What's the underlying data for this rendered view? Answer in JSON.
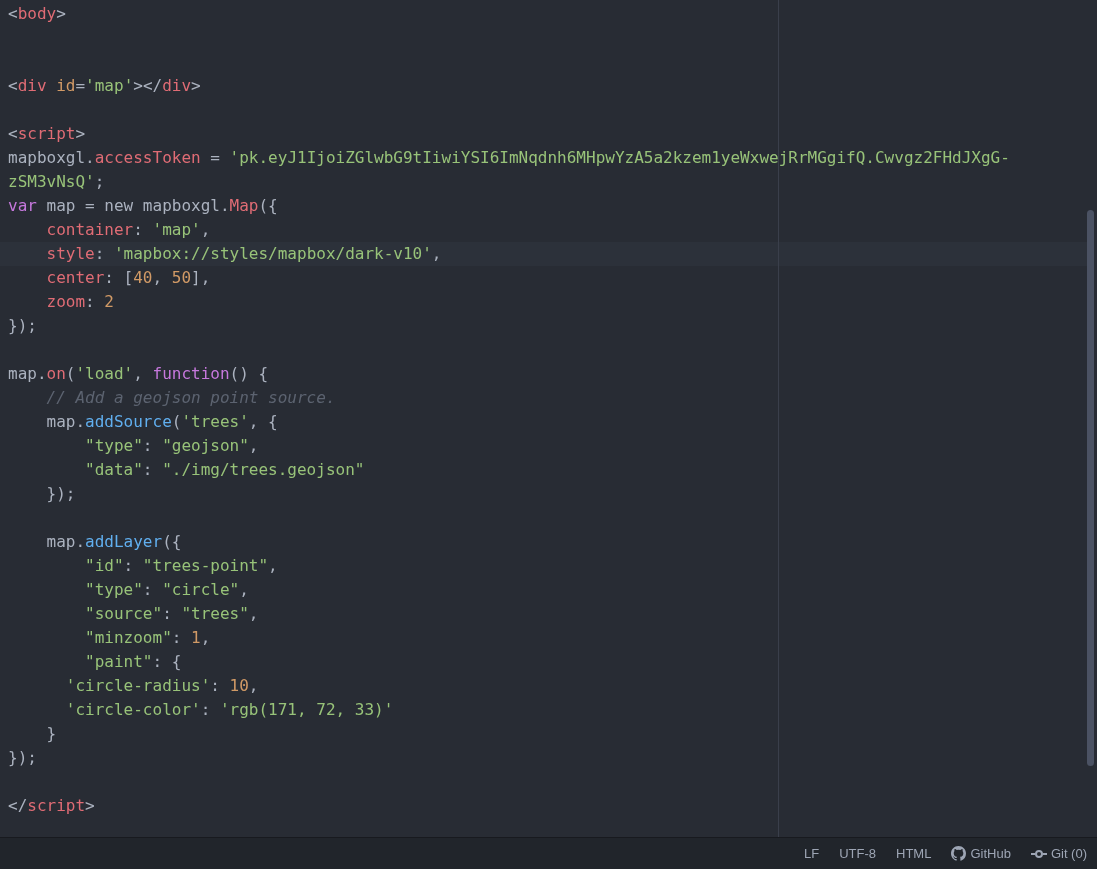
{
  "editor": {
    "lines": [
      {
        "highlighted": false,
        "tokens": [
          {
            "kind": "punct",
            "text": "<"
          },
          {
            "kind": "tag",
            "text": "body"
          },
          {
            "kind": "punct",
            "text": ">"
          }
        ]
      },
      {
        "kind": "blank"
      },
      {
        "kind": "blank"
      },
      {
        "highlighted": false,
        "tokens": [
          {
            "kind": "punct",
            "text": "<"
          },
          {
            "kind": "tag",
            "text": "div"
          },
          {
            "kind": "attr",
            "text": " id"
          },
          {
            "kind": "punct",
            "text": "="
          },
          {
            "kind": "string",
            "text": "'map'"
          },
          {
            "kind": "punct",
            "text": "></"
          },
          {
            "kind": "tag",
            "text": "div"
          },
          {
            "kind": "punct",
            "text": ">"
          }
        ]
      },
      {
        "kind": "blank"
      },
      {
        "highlighted": false,
        "tokens": [
          {
            "kind": "punct",
            "text": "<"
          },
          {
            "kind": "tag",
            "text": "script"
          },
          {
            "kind": "punct",
            "text": ">"
          }
        ]
      },
      {
        "highlighted": false,
        "tokens": [
          {
            "kind": "plain",
            "text": "mapboxgl."
          },
          {
            "kind": "prop",
            "text": "accessToken"
          },
          {
            "kind": "plain",
            "text": " = "
          },
          {
            "kind": "string",
            "text": "'pk.eyJ1IjoiZGlwbG9tIiwiYSI6ImNqdnh6MHpwYzA5a2kzem1yeWxwejRrMGgifQ.Cwvgz2FHdJXgG-"
          }
        ]
      },
      {
        "highlighted": false,
        "tokens": [
          {
            "kind": "string",
            "text": "zSM3vNsQ'"
          },
          {
            "kind": "plain",
            "text": ";"
          }
        ]
      },
      {
        "highlighted": false,
        "tokens": [
          {
            "kind": "keyword",
            "text": "var"
          },
          {
            "kind": "plain",
            "text": " map = new mapboxgl."
          },
          {
            "kind": "prop",
            "text": "Map"
          },
          {
            "kind": "plain",
            "text": "({"
          }
        ]
      },
      {
        "highlighted": false,
        "tokens": [
          {
            "kind": "prop",
            "text": "    container"
          },
          {
            "kind": "plain",
            "text": ": "
          },
          {
            "kind": "string",
            "text": "'map'"
          },
          {
            "kind": "plain",
            "text": ","
          }
        ]
      },
      {
        "highlighted": true,
        "tokens": [
          {
            "kind": "prop",
            "text": "    style"
          },
          {
            "kind": "plain",
            "text": ": "
          },
          {
            "kind": "string",
            "text": "'mapbox://styles/mapbox/dark-v10'"
          },
          {
            "kind": "plain",
            "text": ","
          }
        ]
      },
      {
        "highlighted": false,
        "tokens": [
          {
            "kind": "prop",
            "text": "    center"
          },
          {
            "kind": "plain",
            "text": ": ["
          },
          {
            "kind": "number",
            "text": "40"
          },
          {
            "kind": "plain",
            "text": ", "
          },
          {
            "kind": "number",
            "text": "50"
          },
          {
            "kind": "plain",
            "text": "],"
          }
        ]
      },
      {
        "highlighted": false,
        "tokens": [
          {
            "kind": "prop",
            "text": "    zoom"
          },
          {
            "kind": "plain",
            "text": ": "
          },
          {
            "kind": "number",
            "text": "2"
          }
        ]
      },
      {
        "highlighted": false,
        "tokens": [
          {
            "kind": "plain",
            "text": "});"
          }
        ]
      },
      {
        "kind": "blank"
      },
      {
        "highlighted": false,
        "tokens": [
          {
            "kind": "plain",
            "text": "map."
          },
          {
            "kind": "prop",
            "text": "on"
          },
          {
            "kind": "plain",
            "text": "("
          },
          {
            "kind": "string",
            "text": "'load'"
          },
          {
            "kind": "plain",
            "text": ", "
          },
          {
            "kind": "keyword",
            "text": "function"
          },
          {
            "kind": "plain",
            "text": "() {"
          }
        ]
      },
      {
        "highlighted": false,
        "tokens": [
          {
            "kind": "comment",
            "text": "    // Add a geojson point source."
          }
        ]
      },
      {
        "highlighted": false,
        "tokens": [
          {
            "kind": "plain",
            "text": "    map."
          },
          {
            "kind": "func",
            "text": "addSource"
          },
          {
            "kind": "plain",
            "text": "("
          },
          {
            "kind": "string",
            "text": "'trees'"
          },
          {
            "kind": "plain",
            "text": ", {"
          }
        ]
      },
      {
        "highlighted": false,
        "tokens": [
          {
            "kind": "string",
            "text": "        \"type\""
          },
          {
            "kind": "plain",
            "text": ": "
          },
          {
            "kind": "string",
            "text": "\"geojson\""
          },
          {
            "kind": "plain",
            "text": ","
          }
        ]
      },
      {
        "highlighted": false,
        "tokens": [
          {
            "kind": "string",
            "text": "        \"data\""
          },
          {
            "kind": "plain",
            "text": ": "
          },
          {
            "kind": "string",
            "text": "\"./img/trees.geojson\""
          }
        ]
      },
      {
        "highlighted": false,
        "tokens": [
          {
            "kind": "plain",
            "text": "    });"
          }
        ]
      },
      {
        "kind": "blank"
      },
      {
        "highlighted": false,
        "tokens": [
          {
            "kind": "plain",
            "text": "    map."
          },
          {
            "kind": "func",
            "text": "addLayer"
          },
          {
            "kind": "plain",
            "text": "({"
          }
        ]
      },
      {
        "highlighted": false,
        "tokens": [
          {
            "kind": "string",
            "text": "        \"id\""
          },
          {
            "kind": "plain",
            "text": ": "
          },
          {
            "kind": "string",
            "text": "\"trees-point\""
          },
          {
            "kind": "plain",
            "text": ","
          }
        ]
      },
      {
        "highlighted": false,
        "tokens": [
          {
            "kind": "string",
            "text": "        \"type\""
          },
          {
            "kind": "plain",
            "text": ": "
          },
          {
            "kind": "string",
            "text": "\"circle\""
          },
          {
            "kind": "plain",
            "text": ","
          }
        ]
      },
      {
        "highlighted": false,
        "tokens": [
          {
            "kind": "string",
            "text": "        \"source\""
          },
          {
            "kind": "plain",
            "text": ": "
          },
          {
            "kind": "string",
            "text": "\"trees\""
          },
          {
            "kind": "plain",
            "text": ","
          }
        ]
      },
      {
        "highlighted": false,
        "tokens": [
          {
            "kind": "string",
            "text": "        \"minzoom\""
          },
          {
            "kind": "plain",
            "text": ": "
          },
          {
            "kind": "number",
            "text": "1"
          },
          {
            "kind": "plain",
            "text": ","
          }
        ]
      },
      {
        "highlighted": false,
        "tokens": [
          {
            "kind": "string",
            "text": "        \"paint\""
          },
          {
            "kind": "plain",
            "text": ": {"
          }
        ]
      },
      {
        "highlighted": false,
        "tokens": [
          {
            "kind": "string",
            "text": "      'circle-radius'"
          },
          {
            "kind": "plain",
            "text": ": "
          },
          {
            "kind": "number",
            "text": "10"
          },
          {
            "kind": "plain",
            "text": ","
          }
        ]
      },
      {
        "highlighted": false,
        "tokens": [
          {
            "kind": "string",
            "text": "      'circle-color'"
          },
          {
            "kind": "plain",
            "text": ": "
          },
          {
            "kind": "string",
            "text": "'rgb(171, 72, 33)'"
          }
        ]
      },
      {
        "highlighted": false,
        "tokens": [
          {
            "kind": "plain",
            "text": "    }"
          }
        ]
      },
      {
        "highlighted": false,
        "tokens": [
          {
            "kind": "plain",
            "text": "});"
          }
        ]
      },
      {
        "kind": "blank"
      },
      {
        "highlighted": false,
        "tokens": [
          {
            "kind": "punct",
            "text": "</"
          },
          {
            "kind": "tag",
            "text": "script"
          },
          {
            "kind": "punct",
            "text": ">"
          }
        ]
      }
    ]
  },
  "status_bar": {
    "items": [
      {
        "kind": "text",
        "label": "LF"
      },
      {
        "kind": "text",
        "label": "UTF-8"
      },
      {
        "kind": "text",
        "label": "HTML"
      },
      {
        "kind": "github",
        "label": "GitHub"
      },
      {
        "kind": "git",
        "label": "Git (0)"
      }
    ]
  }
}
